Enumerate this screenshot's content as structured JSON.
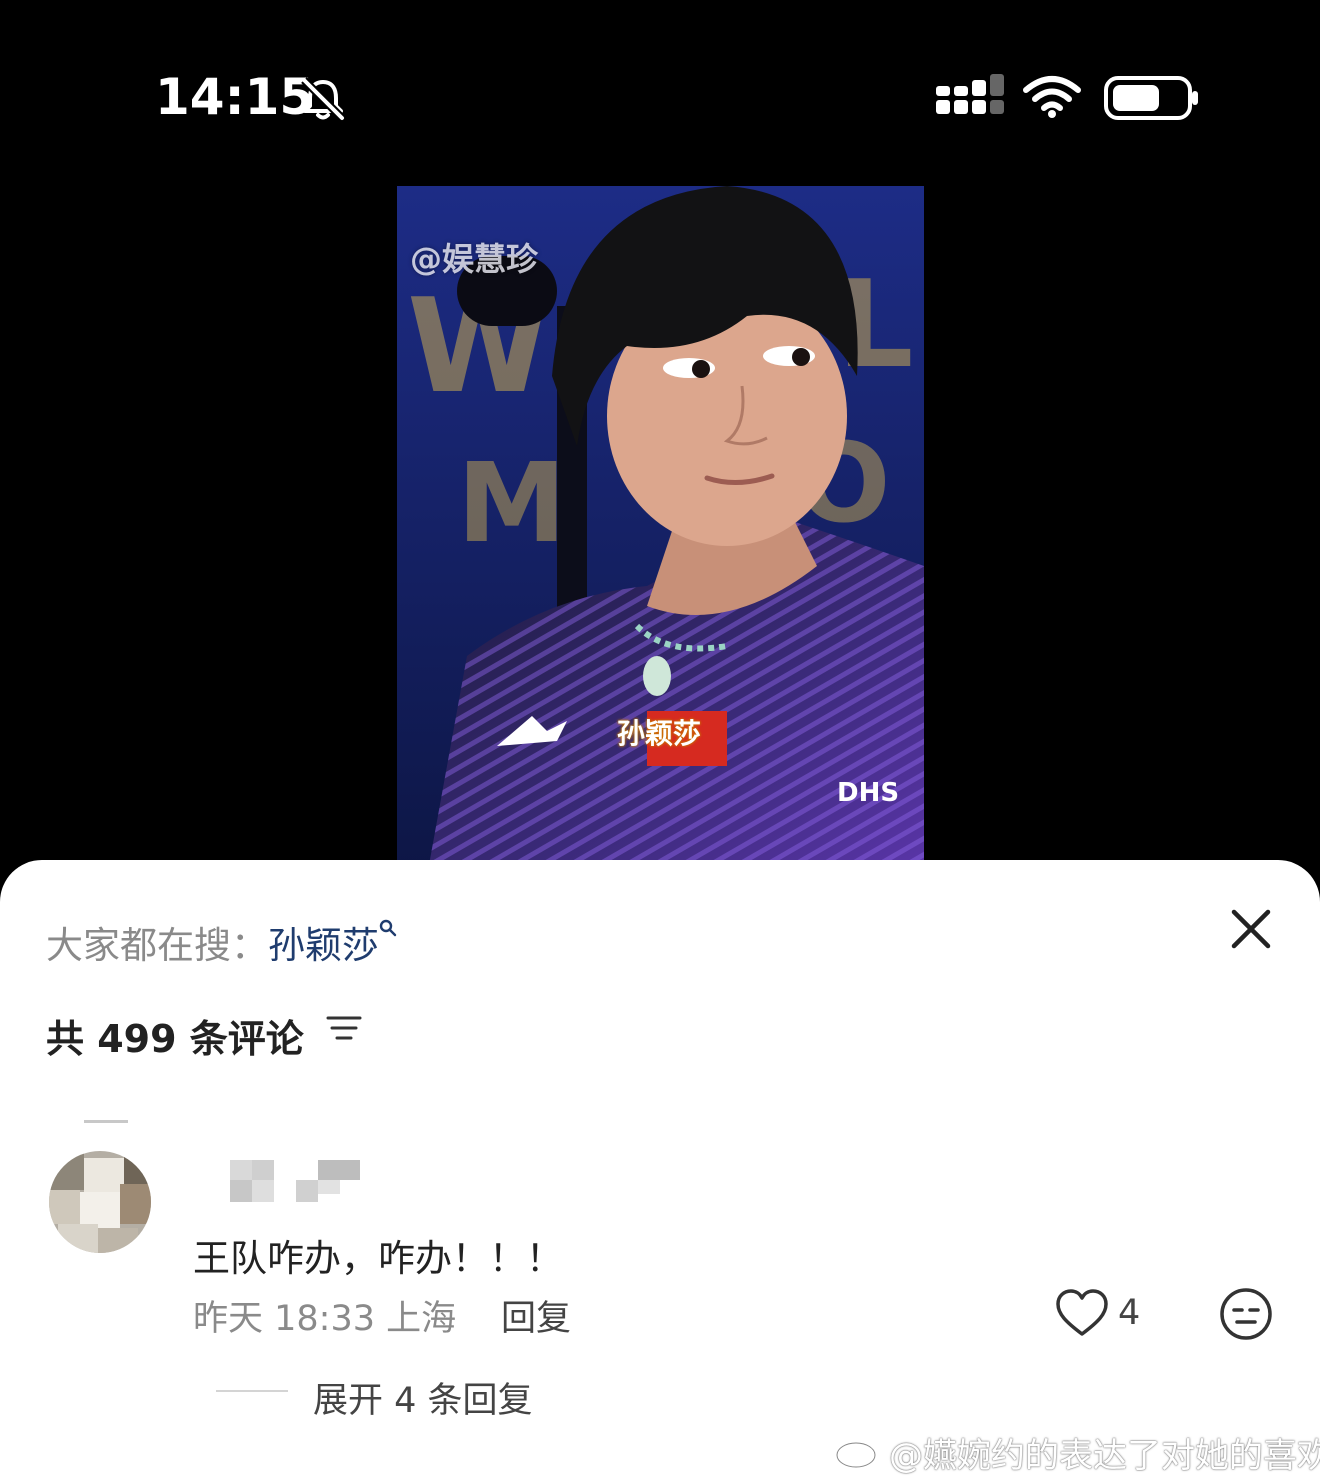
{
  "status_bar": {
    "time": "14:15",
    "icons": [
      "bell-slash-icon",
      "signal-icon",
      "wifi-icon",
      "battery-icon"
    ]
  },
  "video": {
    "watermark": "@娱慧珍",
    "jersey_name": "孙颖莎"
  },
  "comments_panel": {
    "hot_search_prefix": "大家都在搜：",
    "hot_search_keyword": "孙颖莎",
    "comment_count_label": "共 499 条评论",
    "close_icon": "close-icon",
    "sort_icon": "sort-filter-icon"
  },
  "comments": [
    {
      "text": "王队咋办，咋办！！！",
      "time": "昨天 18:33",
      "location": "上海",
      "meta": "昨天 18:33 上海",
      "reply_label": "回复",
      "like_count": "4",
      "expand_label": "展开 4 条回复"
    }
  ],
  "footer_watermark": "@嬿婉约的表达了对她的喜欢",
  "colors": {
    "background": "#000000",
    "sheet": "#ffffff",
    "keyword_link": "#1f3c6e",
    "muted_text": "#8a8a8a"
  }
}
